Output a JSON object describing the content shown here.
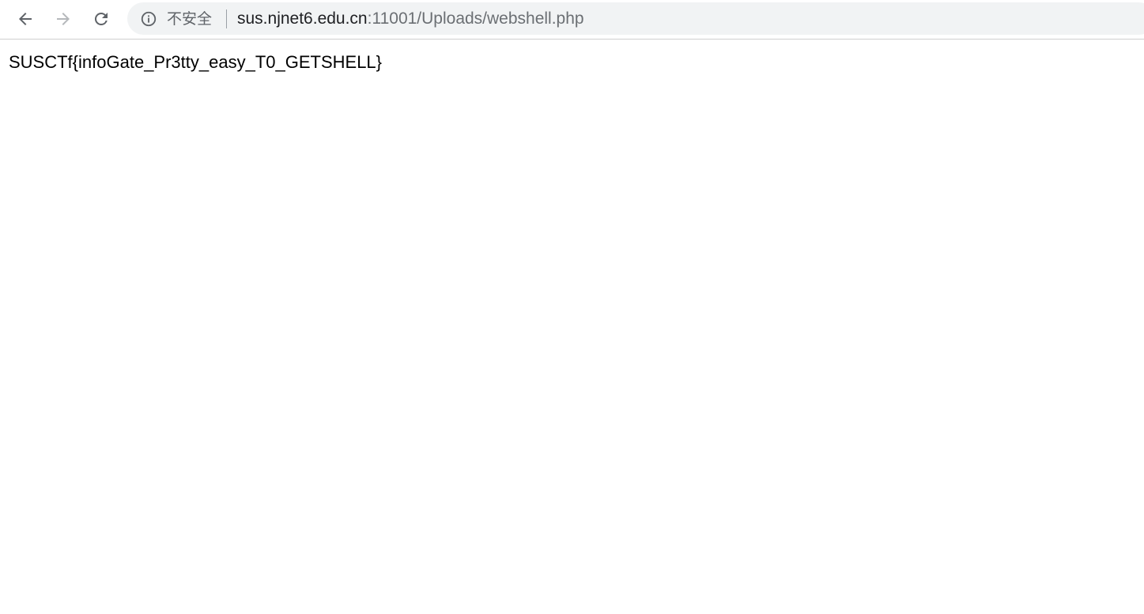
{
  "toolbar": {
    "back_icon": "arrow-left-icon",
    "forward_icon": "arrow-right-icon",
    "reload_icon": "reload-icon"
  },
  "omnibox": {
    "info_icon": "info-circle-icon",
    "security_label": "不安全",
    "url_host": "sus.njnet6.edu.cn",
    "url_rest": ":11001/Uploads/webshell.php"
  },
  "page": {
    "body_text": "SUSCTf{infoGate_Pr3tty_easy_T0_GETSHELL}"
  },
  "colors": {
    "omnibox_bg": "#f1f3f4",
    "security_text": "#5f6368",
    "url_host": "#202124",
    "url_rest": "#6b6f73"
  }
}
